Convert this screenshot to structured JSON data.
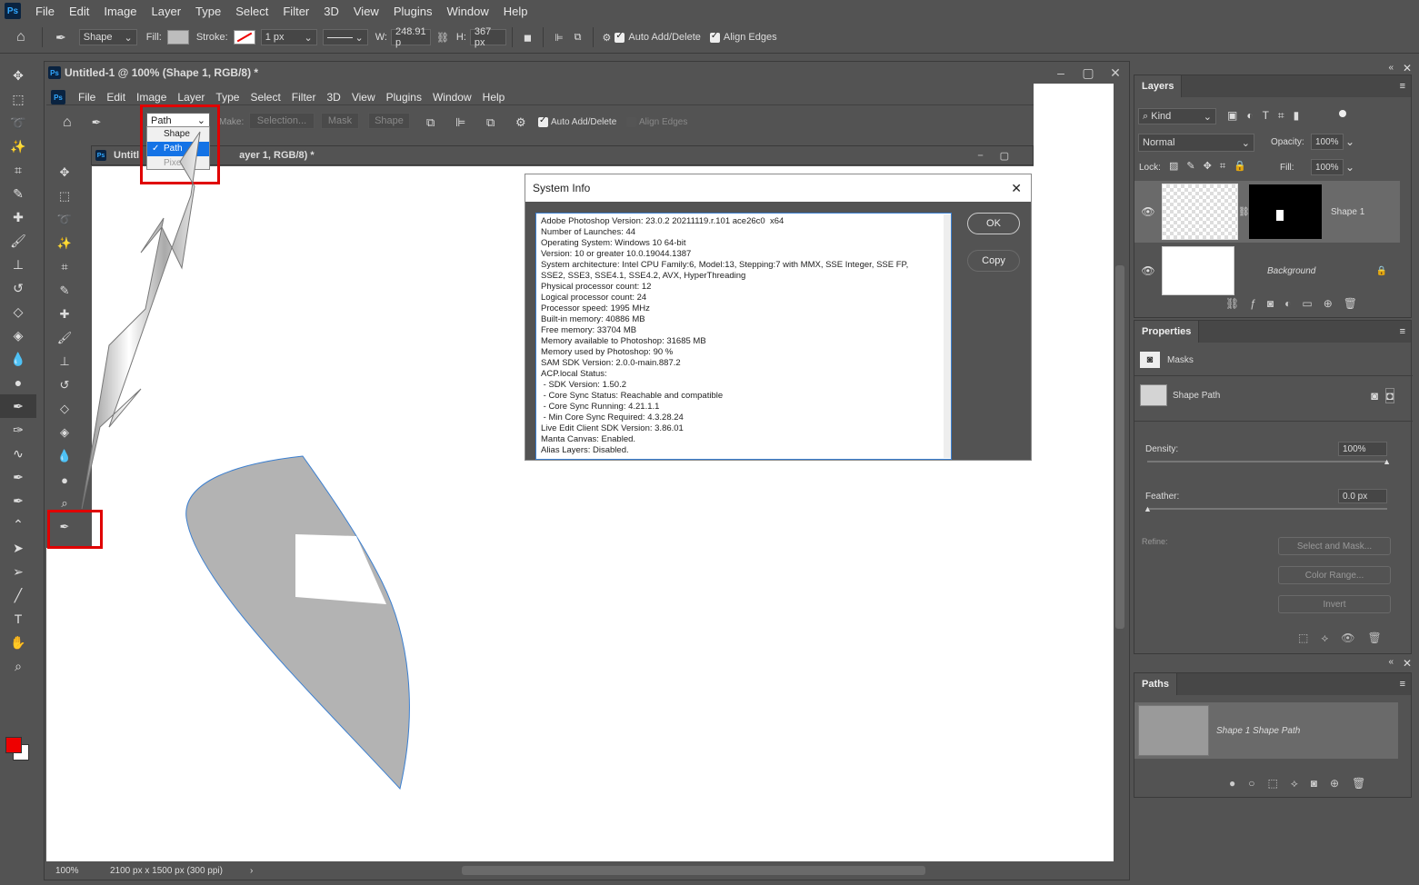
{
  "app": {
    "logo": "Ps",
    "menu": [
      "File",
      "Edit",
      "Image",
      "Layer",
      "Type",
      "Select",
      "Filter",
      "3D",
      "View",
      "Plugins",
      "Window",
      "Help"
    ]
  },
  "options": {
    "mode": "Shape",
    "fill_label": "Fill:",
    "stroke_label": "Stroke:",
    "stroke_width": "1 px",
    "w_label": "W:",
    "w_value": "248.91 p",
    "h_label": "H:",
    "h_value": "367 px",
    "auto_add": "Auto Add/Delete",
    "align_edges": "Align Edges"
  },
  "outer_doc": {
    "title": "Untitled-1 @ 100% (Shape 1, RGB/8) *",
    "zoom": "100%",
    "size": "2100 px x 1500 px (300 ppi)"
  },
  "inner_app": {
    "menu": [
      "File",
      "Edit",
      "Image",
      "Layer",
      "Type",
      "Select",
      "Filter",
      "3D",
      "View",
      "Plugins",
      "Window",
      "Help"
    ],
    "mode": "Path",
    "make_label": "Make:",
    "selection_btn": "Selection...",
    "mask_btn": "Mask",
    "shape_btn": "Shape",
    "auto_add": "Auto Add/Delete",
    "align_edges": "Align Edges",
    "doc_title_left": "Untitl",
    "doc_title_right": "ayer 1, RGB/8) *",
    "dropdown": [
      "Shape",
      "Path",
      "Pixel"
    ]
  },
  "sysinfo": {
    "title": "System Info",
    "ok": "OK",
    "copy": "Copy",
    "lines": [
      "Adobe Photoshop Version: 23.0.2 20211119.r.101 ace26c0  x64",
      "Number of Launches: 44",
      "Operating System: Windows 10 64-bit",
      "Version: 10 or greater 10.0.19044.1387",
      "System architecture: Intel CPU Family:6, Model:13, Stepping:7 with MMX, SSE Integer, SSE FP,",
      "SSE2, SSE3, SSE4.1, SSE4.2, AVX, HyperThreading",
      "Physical processor count: 12",
      "Logical processor count: 24",
      "Processor speed: 1995 MHz",
      "Built-in memory: 40886 MB",
      "Free memory: 33704 MB",
      "Memory available to Photoshop: 31685 MB",
      "Memory used by Photoshop: 90 %",
      "SAM SDK Version: 2.0.0-main.887.2",
      "ACP.local Status:",
      " - SDK Version: 1.50.2",
      " - Core Sync Status: Reachable and compatible",
      " - Core Sync Running: 4.21.1.1",
      " - Min Core Sync Required: 4.3.28.24",
      "Live Edit Client SDK Version: 3.86.01",
      "Manta Canvas: Enabled.",
      "Alias Layers: Disabled."
    ]
  },
  "layers": {
    "tab": "Layers",
    "kind": "Kind",
    "blend": "Normal",
    "opacity_label": "Opacity:",
    "opacity": "100%",
    "lock_label": "Lock:",
    "fill_label": "Fill:",
    "fill": "100%",
    "items": [
      {
        "name": "Shape 1"
      },
      {
        "name": "Background"
      }
    ]
  },
  "properties": {
    "tab": "Properties",
    "masks": "Masks",
    "shape_path": "Shape Path",
    "density_label": "Density:",
    "density": "100%",
    "feather_label": "Feather:",
    "feather": "0.0 px",
    "refine_label": "Refine:",
    "select_mask": "Select and Mask...",
    "color_range": "Color Range...",
    "invert": "Invert"
  },
  "paths": {
    "tab": "Paths",
    "item": "Shape 1 Shape Path"
  },
  "colors": {
    "accent": "#e00000",
    "highlight": "#1473e6"
  }
}
